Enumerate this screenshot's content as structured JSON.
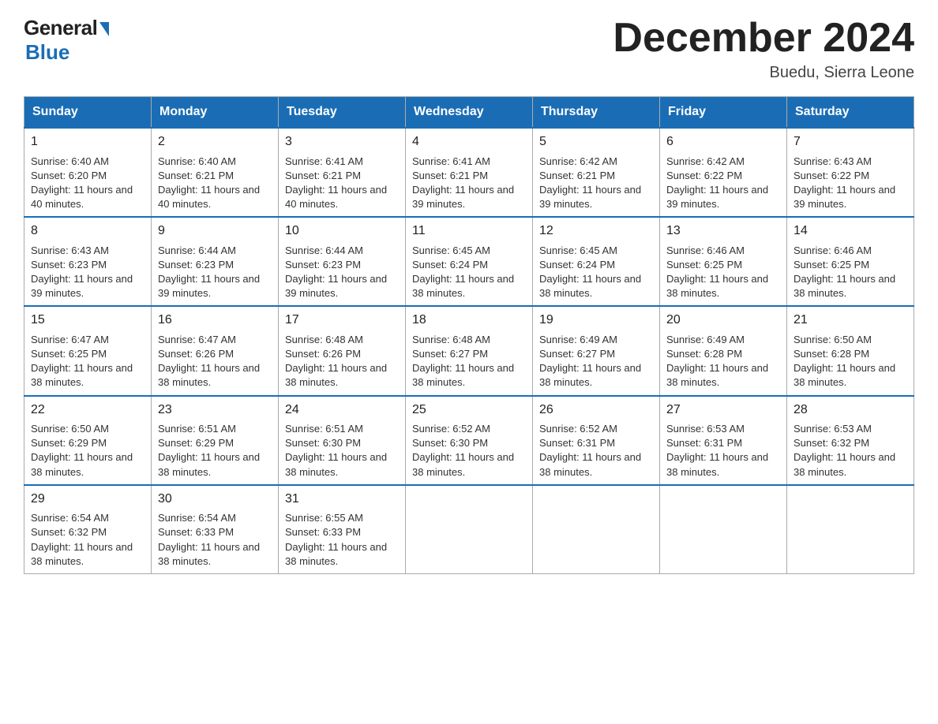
{
  "logo": {
    "general": "General",
    "blue": "Blue"
  },
  "title": "December 2024",
  "location": "Buedu, Sierra Leone",
  "days_of_week": [
    "Sunday",
    "Monday",
    "Tuesday",
    "Wednesday",
    "Thursday",
    "Friday",
    "Saturday"
  ],
  "weeks": [
    [
      {
        "day": "1",
        "sunrise": "6:40 AM",
        "sunset": "6:20 PM",
        "daylight": "11 hours and 40 minutes."
      },
      {
        "day": "2",
        "sunrise": "6:40 AM",
        "sunset": "6:21 PM",
        "daylight": "11 hours and 40 minutes."
      },
      {
        "day": "3",
        "sunrise": "6:41 AM",
        "sunset": "6:21 PM",
        "daylight": "11 hours and 40 minutes."
      },
      {
        "day": "4",
        "sunrise": "6:41 AM",
        "sunset": "6:21 PM",
        "daylight": "11 hours and 39 minutes."
      },
      {
        "day": "5",
        "sunrise": "6:42 AM",
        "sunset": "6:21 PM",
        "daylight": "11 hours and 39 minutes."
      },
      {
        "day": "6",
        "sunrise": "6:42 AM",
        "sunset": "6:22 PM",
        "daylight": "11 hours and 39 minutes."
      },
      {
        "day": "7",
        "sunrise": "6:43 AM",
        "sunset": "6:22 PM",
        "daylight": "11 hours and 39 minutes."
      }
    ],
    [
      {
        "day": "8",
        "sunrise": "6:43 AM",
        "sunset": "6:23 PM",
        "daylight": "11 hours and 39 minutes."
      },
      {
        "day": "9",
        "sunrise": "6:44 AM",
        "sunset": "6:23 PM",
        "daylight": "11 hours and 39 minutes."
      },
      {
        "day": "10",
        "sunrise": "6:44 AM",
        "sunset": "6:23 PM",
        "daylight": "11 hours and 39 minutes."
      },
      {
        "day": "11",
        "sunrise": "6:45 AM",
        "sunset": "6:24 PM",
        "daylight": "11 hours and 38 minutes."
      },
      {
        "day": "12",
        "sunrise": "6:45 AM",
        "sunset": "6:24 PM",
        "daylight": "11 hours and 38 minutes."
      },
      {
        "day": "13",
        "sunrise": "6:46 AM",
        "sunset": "6:25 PM",
        "daylight": "11 hours and 38 minutes."
      },
      {
        "day": "14",
        "sunrise": "6:46 AM",
        "sunset": "6:25 PM",
        "daylight": "11 hours and 38 minutes."
      }
    ],
    [
      {
        "day": "15",
        "sunrise": "6:47 AM",
        "sunset": "6:25 PM",
        "daylight": "11 hours and 38 minutes."
      },
      {
        "day": "16",
        "sunrise": "6:47 AM",
        "sunset": "6:26 PM",
        "daylight": "11 hours and 38 minutes."
      },
      {
        "day": "17",
        "sunrise": "6:48 AM",
        "sunset": "6:26 PM",
        "daylight": "11 hours and 38 minutes."
      },
      {
        "day": "18",
        "sunrise": "6:48 AM",
        "sunset": "6:27 PM",
        "daylight": "11 hours and 38 minutes."
      },
      {
        "day": "19",
        "sunrise": "6:49 AM",
        "sunset": "6:27 PM",
        "daylight": "11 hours and 38 minutes."
      },
      {
        "day": "20",
        "sunrise": "6:49 AM",
        "sunset": "6:28 PM",
        "daylight": "11 hours and 38 minutes."
      },
      {
        "day": "21",
        "sunrise": "6:50 AM",
        "sunset": "6:28 PM",
        "daylight": "11 hours and 38 minutes."
      }
    ],
    [
      {
        "day": "22",
        "sunrise": "6:50 AM",
        "sunset": "6:29 PM",
        "daylight": "11 hours and 38 minutes."
      },
      {
        "day": "23",
        "sunrise": "6:51 AM",
        "sunset": "6:29 PM",
        "daylight": "11 hours and 38 minutes."
      },
      {
        "day": "24",
        "sunrise": "6:51 AM",
        "sunset": "6:30 PM",
        "daylight": "11 hours and 38 minutes."
      },
      {
        "day": "25",
        "sunrise": "6:52 AM",
        "sunset": "6:30 PM",
        "daylight": "11 hours and 38 minutes."
      },
      {
        "day": "26",
        "sunrise": "6:52 AM",
        "sunset": "6:31 PM",
        "daylight": "11 hours and 38 minutes."
      },
      {
        "day": "27",
        "sunrise": "6:53 AM",
        "sunset": "6:31 PM",
        "daylight": "11 hours and 38 minutes."
      },
      {
        "day": "28",
        "sunrise": "6:53 AM",
        "sunset": "6:32 PM",
        "daylight": "11 hours and 38 minutes."
      }
    ],
    [
      {
        "day": "29",
        "sunrise": "6:54 AM",
        "sunset": "6:32 PM",
        "daylight": "11 hours and 38 minutes."
      },
      {
        "day": "30",
        "sunrise": "6:54 AM",
        "sunset": "6:33 PM",
        "daylight": "11 hours and 38 minutes."
      },
      {
        "day": "31",
        "sunrise": "6:55 AM",
        "sunset": "6:33 PM",
        "daylight": "11 hours and 38 minutes."
      },
      null,
      null,
      null,
      null
    ]
  ]
}
